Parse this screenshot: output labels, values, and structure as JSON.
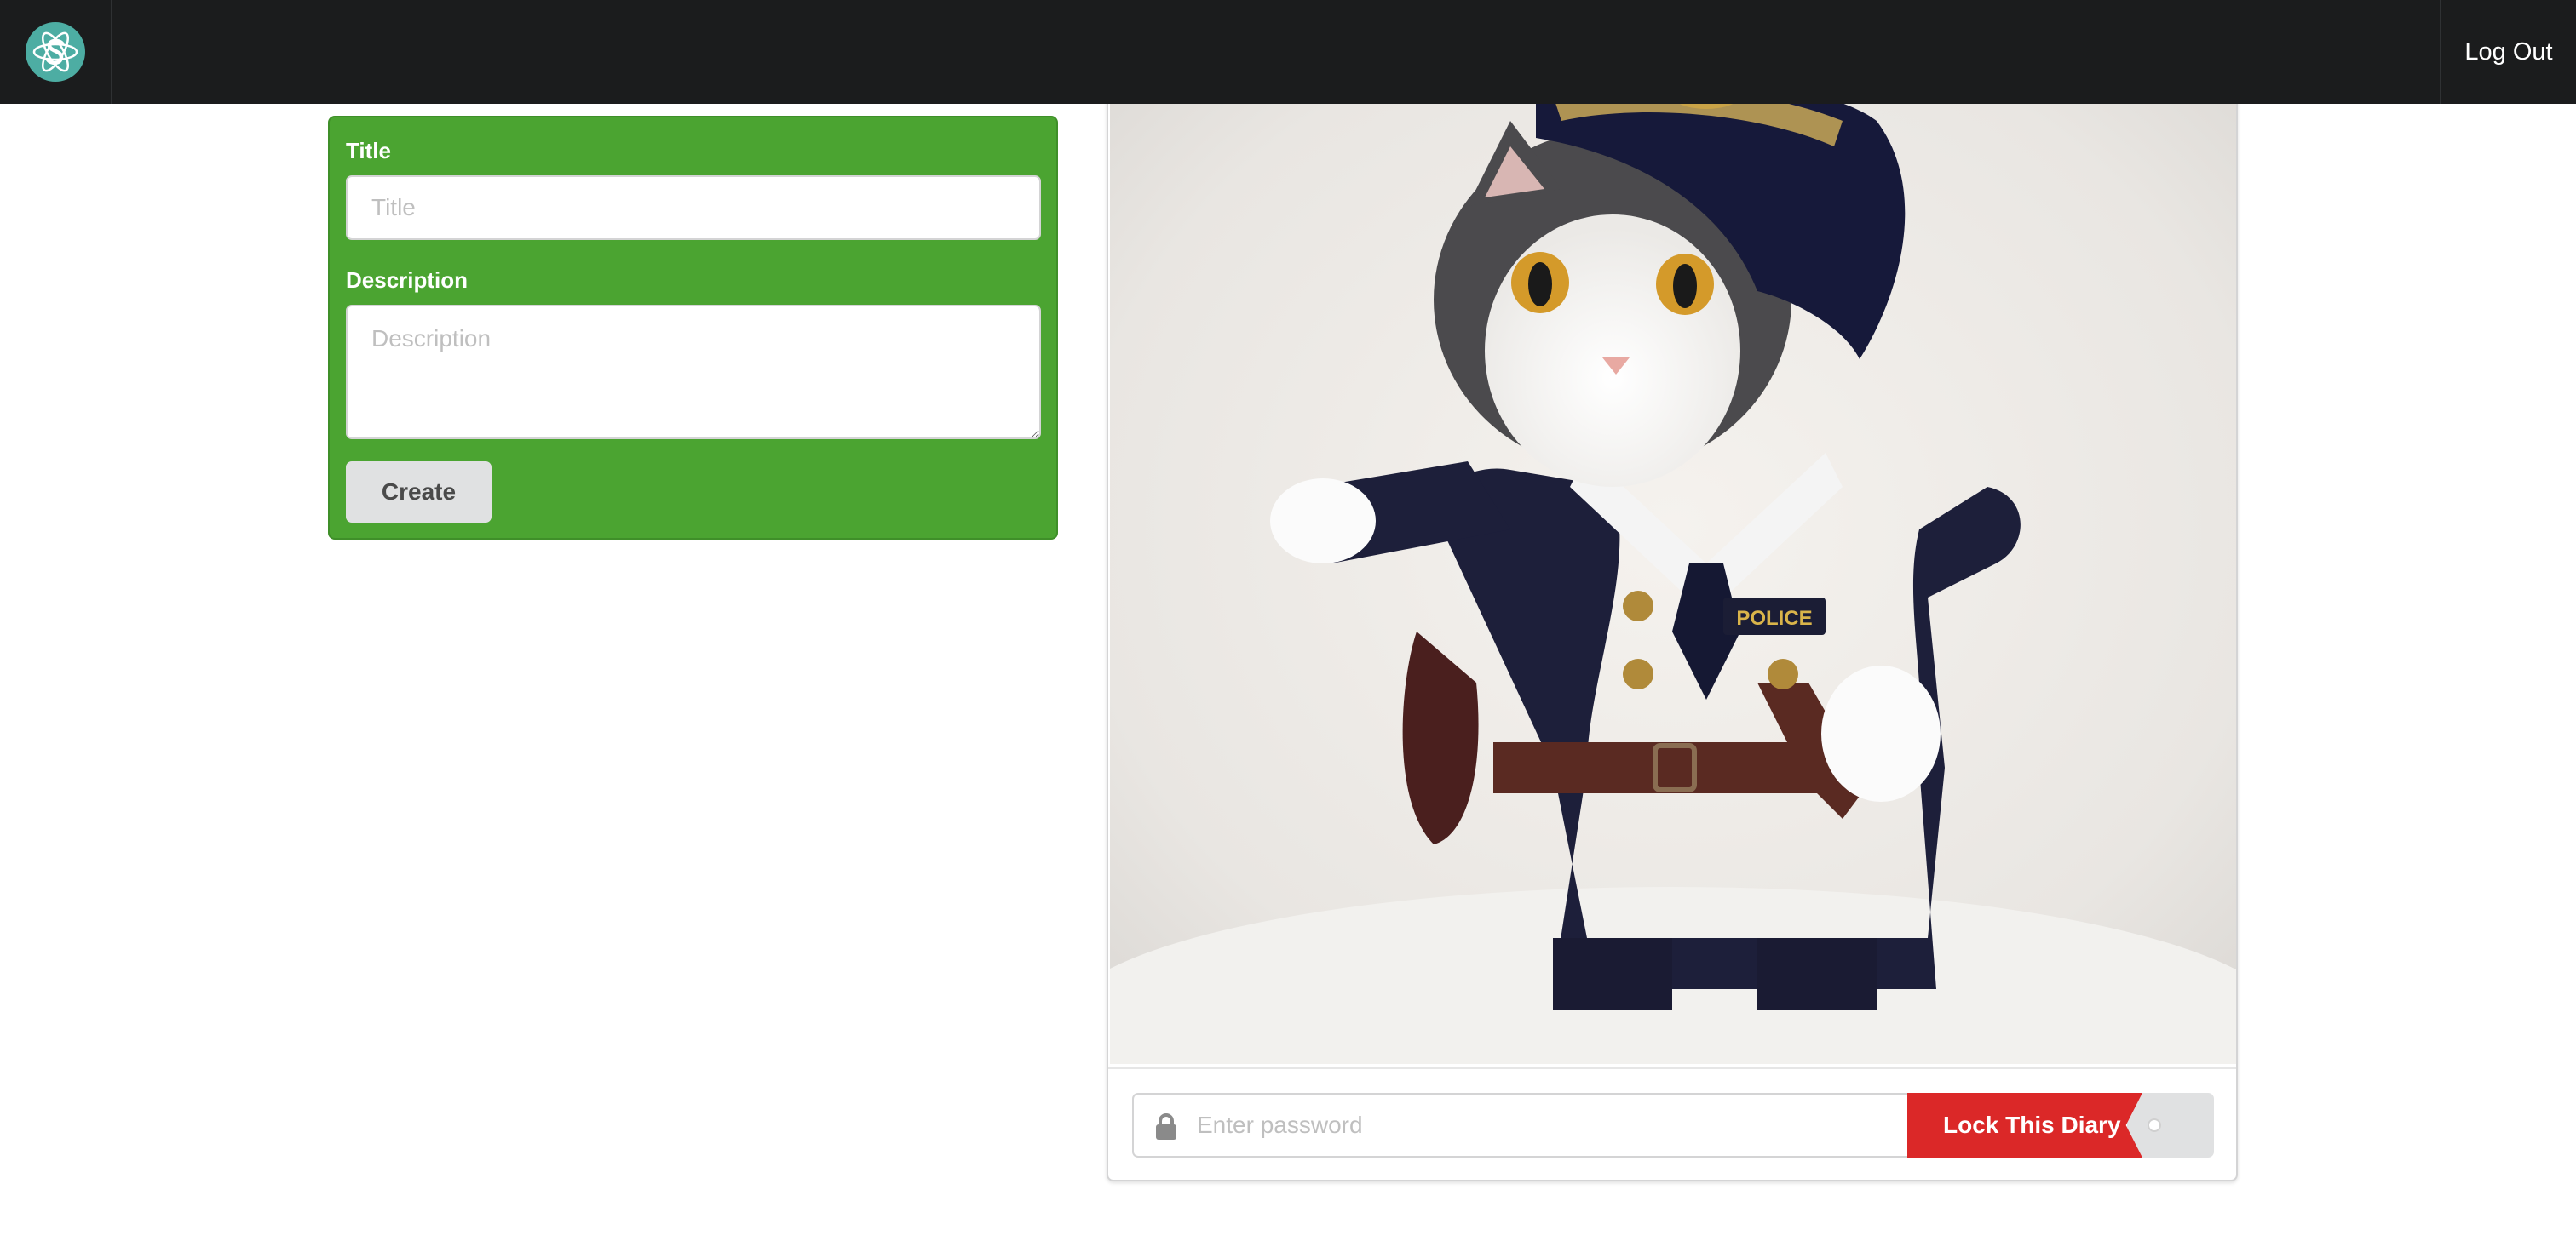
{
  "navbar": {
    "logo_icon": "app-logo-icon",
    "logout_label": "Log Out"
  },
  "form": {
    "title_label": "Title",
    "title_placeholder": "Title",
    "title_value": "",
    "description_label": "Description",
    "description_placeholder": "Description",
    "description_value": "",
    "create_label": "Create"
  },
  "diary": {
    "image_subject": "cat-in-police-costume",
    "password_icon": "lock-icon",
    "password_placeholder": "Enter password",
    "password_value": "",
    "lock_button_label": "Lock This Diary",
    "lock_toggle_on": false
  },
  "colors": {
    "navbar_bg": "#1b1c1d",
    "form_bg": "#4ba431",
    "lock_button_bg": "#db2828",
    "logo_teal": "#4dada3"
  }
}
